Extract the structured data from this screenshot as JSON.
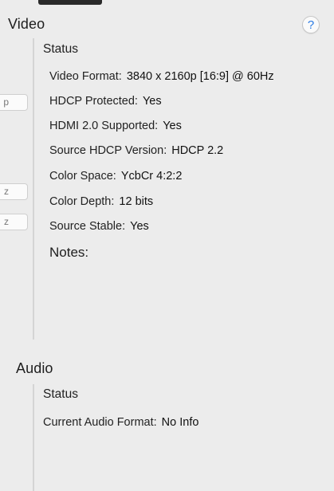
{
  "video": {
    "title": "Video",
    "help_glyph": "?",
    "status_label": "Status",
    "fields": [
      {
        "label": "Video Format:",
        "value": "3840 x 2160p [16:9] @ 60Hz"
      },
      {
        "label": "HDCP Protected:",
        "value": "Yes"
      },
      {
        "label": "HDMI 2.0 Supported:",
        "value": "Yes"
      },
      {
        "label": "Source HDCP Version:",
        "value": "HDCP 2.2"
      },
      {
        "label": "Color Space:",
        "value": "YcbCr 4:2:2"
      },
      {
        "label": "Color Depth:",
        "value": "12 bits"
      },
      {
        "label": "Source Stable:",
        "value": "Yes"
      }
    ],
    "notes_label": "Notes:"
  },
  "side_controls": [
    "p",
    "z",
    "z"
  ],
  "audio": {
    "title": "Audio",
    "status_label": "Status",
    "fields": [
      {
        "label": "Current Audio Format:",
        "value": "No Info"
      }
    ]
  },
  "colors": {
    "accent": "#2a7be4",
    "background": "#ececec"
  },
  "icons": {
    "help": "help-icon"
  }
}
